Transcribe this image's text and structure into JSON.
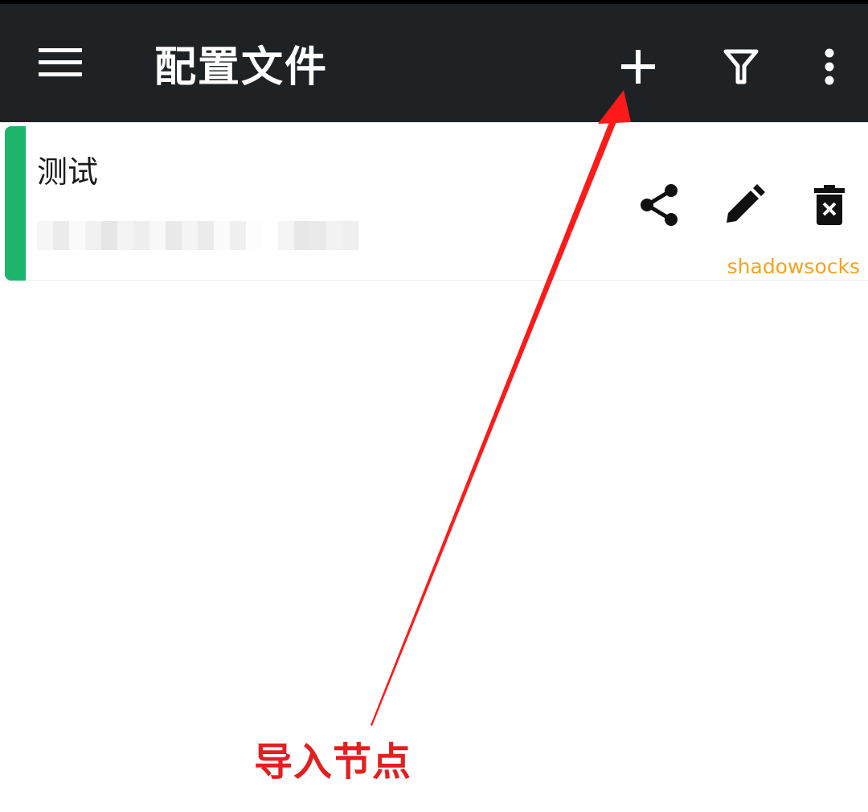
{
  "toolbar": {
    "title": "配置文件",
    "menu_icon": "hamburger-menu-icon",
    "add_icon": "plus-icon",
    "filter_icon": "filter-icon",
    "more_icon": "more-vertical-icon",
    "background": "#1f2225"
  },
  "profiles": [
    {
      "name": "测试",
      "address_blurred": true,
      "type": "shadowsocks",
      "selected": true,
      "selected_color": "#1cb56b",
      "type_color": "#f3a420",
      "actions": [
        "share-icon",
        "edit-icon",
        "delete-icon"
      ]
    }
  ],
  "annotation": {
    "label": "导入节点",
    "color": "#e41f1f",
    "points_to": "add-button"
  }
}
